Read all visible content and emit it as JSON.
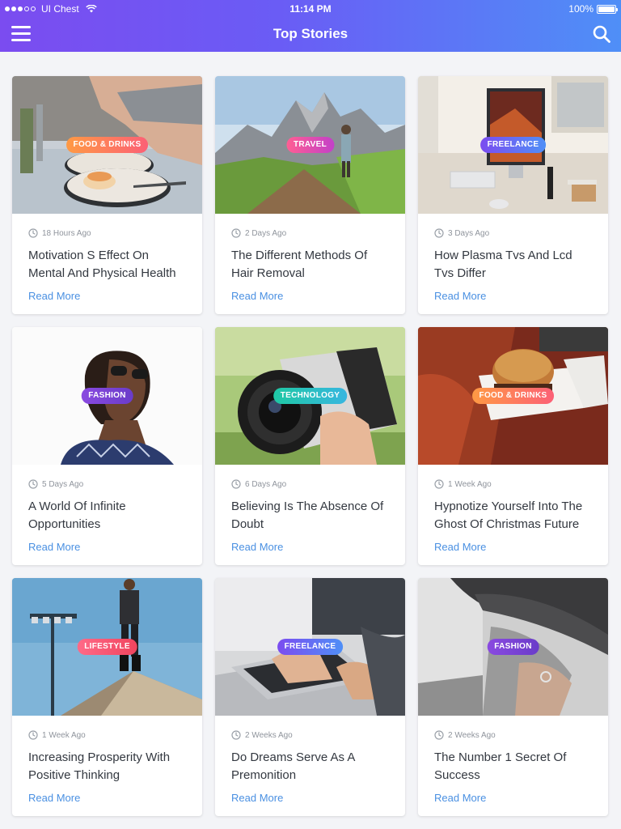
{
  "status": {
    "carrier": "UI Chest",
    "time": "11:14 PM",
    "battery": "100%"
  },
  "header": {
    "title": "Top Stories"
  },
  "cards": [
    {
      "tag": "FOOD & DRINKS",
      "tag_style": "food",
      "time": "18 Hours Ago",
      "title": "Motivation S Effect On Mental And Physical Health",
      "cta": "Read More",
      "image": "food-plate-photo"
    },
    {
      "tag": "TRAVEL",
      "tag_style": "travel",
      "time": "2 Days Ago",
      "title": "The Different Methods Of Hair Removal",
      "cta": "Read More",
      "image": "mountain-hiker-photo"
    },
    {
      "tag": "FREELANCE",
      "tag_style": "freelance",
      "time": "3 Days Ago",
      "title": "How Plasma Tvs And Lcd Tvs Differ",
      "cta": "Read More",
      "image": "desk-computer-photo"
    },
    {
      "tag": "FASHION",
      "tag_style": "fashion",
      "time": "5 Days Ago",
      "title": "A World Of Infinite Opportunities",
      "cta": "Read More",
      "image": "woman-sunglasses-photo"
    },
    {
      "tag": "TECHNOLOGY",
      "tag_style": "technology",
      "time": "6 Days Ago",
      "title": "Believing Is The Absence Of Doubt",
      "cta": "Read More",
      "image": "camera-hand-photo"
    },
    {
      "tag": "FOOD & DRINKS",
      "tag_style": "food",
      "time": "1 Week Ago",
      "title": "Hypnotize Yourself Into The Ghost Of Christmas Future",
      "cta": "Read More",
      "image": "burger-box-photo"
    },
    {
      "tag": "LIFESTYLE",
      "tag_style": "lifestyle",
      "time": "1 Week Ago",
      "title": "Increasing Prosperity With Positive Thinking",
      "cta": "Read More",
      "image": "man-rooftop-photo"
    },
    {
      "tag": "FREELANCE",
      "tag_style": "freelance",
      "time": "2 Weeks Ago",
      "title": "Do Dreams Serve As A Premonition",
      "cta": "Read More",
      "image": "laptop-typing-photo"
    },
    {
      "tag": "FASHION",
      "tag_style": "fashion",
      "time": "2 Weeks Ago",
      "title": "The Number 1 Secret Of Success",
      "cta": "Read More",
      "image": "hat-woman-photo"
    }
  ]
}
